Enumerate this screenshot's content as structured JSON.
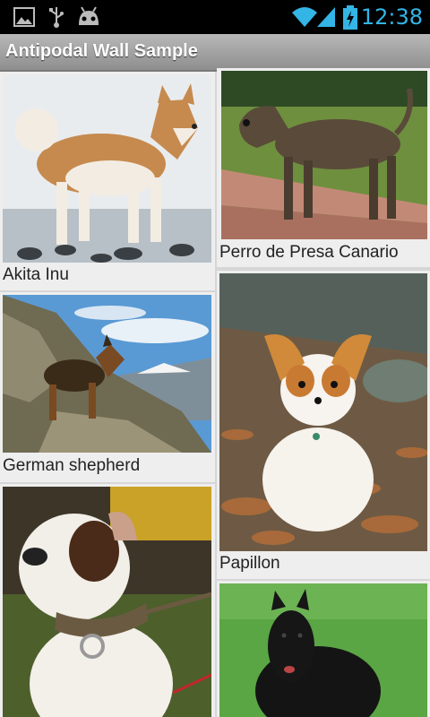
{
  "status_bar": {
    "time": "12:38",
    "icons": [
      "image-icon",
      "usb-icon",
      "android-icon",
      "wifi-icon",
      "signal-icon",
      "battery-charging-icon"
    ]
  },
  "app": {
    "title": "Antipodal Wall Sample"
  },
  "cards": [
    {
      "caption": "Akita Inu",
      "image": "akita-inu-photo"
    },
    {
      "caption": "Perro de Presa Canario",
      "image": "perro-de-presa-canario-photo"
    },
    {
      "caption": "German shepherd",
      "image": "german-shepherd-photo"
    },
    {
      "caption": "Papillon",
      "image": "papillon-photo"
    },
    {
      "caption": "",
      "image": "bulldog-photo"
    },
    {
      "caption": "",
      "image": "belgian-shepherd-photo"
    }
  ]
}
